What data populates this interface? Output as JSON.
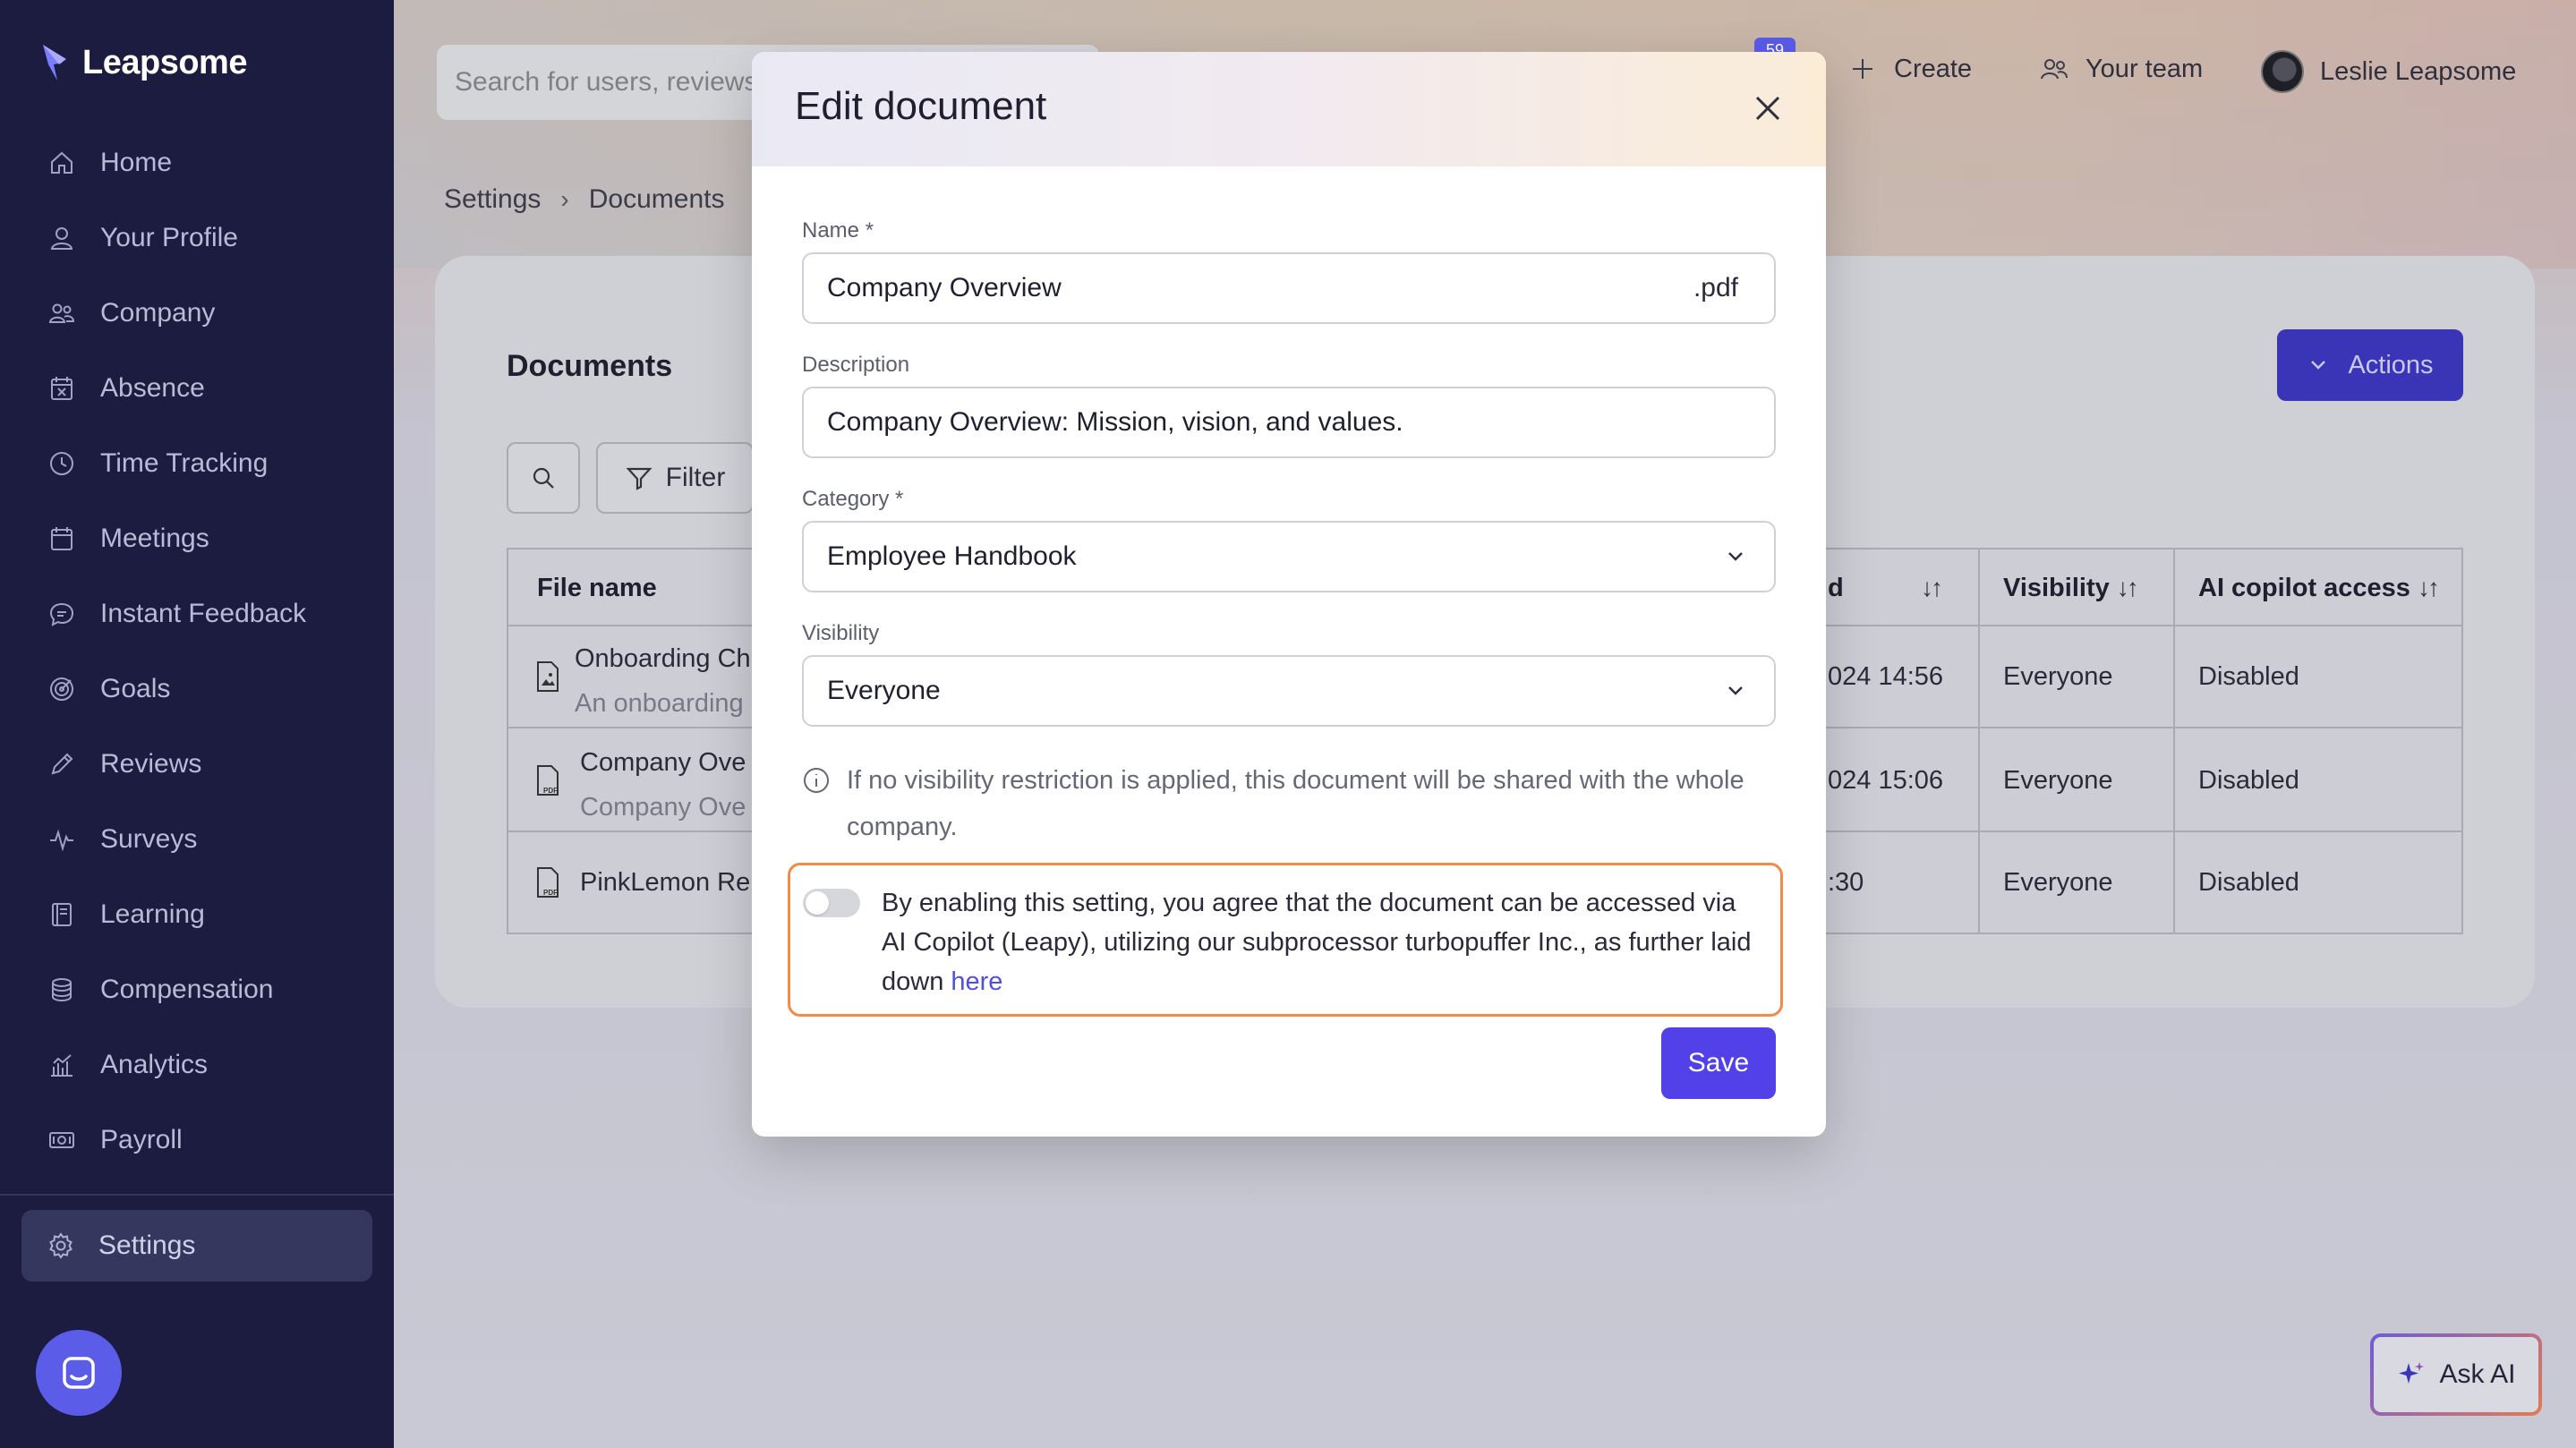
{
  "app": {
    "name": "Leapsome"
  },
  "sidebar": {
    "items": [
      {
        "label": "Home",
        "icon": "home-icon"
      },
      {
        "label": "Your Profile",
        "icon": "user-icon"
      },
      {
        "label": "Company",
        "icon": "people-icon"
      },
      {
        "label": "Absence",
        "icon": "calendar-x-icon"
      },
      {
        "label": "Time Tracking",
        "icon": "clock-icon"
      },
      {
        "label": "Meetings",
        "icon": "calendar-icon"
      },
      {
        "label": "Instant Feedback",
        "icon": "chat-icon"
      },
      {
        "label": "Goals",
        "icon": "target-icon"
      },
      {
        "label": "Reviews",
        "icon": "pencil-icon"
      },
      {
        "label": "Surveys",
        "icon": "pulse-icon"
      },
      {
        "label": "Learning",
        "icon": "book-icon"
      },
      {
        "label": "Compensation",
        "icon": "coins-icon"
      },
      {
        "label": "Analytics",
        "icon": "chart-icon"
      },
      {
        "label": "Payroll",
        "icon": "money-icon"
      }
    ],
    "settings_label": "Settings"
  },
  "topbar": {
    "search_placeholder": "Search for users, reviews",
    "notification_count": "59",
    "create_label": "Create",
    "team_label": "Your team",
    "user_name": "Leslie Leapsome"
  },
  "breadcrumb": {
    "root": "Settings",
    "current": "Documents"
  },
  "documents": {
    "title": "Documents",
    "actions_label": "Actions",
    "filter_label": "Filter",
    "columns": {
      "file_name": "File name",
      "updated": "d",
      "visibility": "Visibility",
      "ai_access": "AI copilot access"
    },
    "rows": [
      {
        "name": "Onboarding Ch",
        "sub": "An onboarding",
        "updated": "024 14:56",
        "visibility": "Everyone",
        "ai_access": "Disabled"
      },
      {
        "name": "Company Ove",
        "sub": "Company Ove",
        "updated": "024 15:06",
        "visibility": "Everyone",
        "ai_access": "Disabled"
      },
      {
        "name": "PinkLemon Re",
        "sub": "",
        "updated": ":30",
        "visibility": "Everyone",
        "ai_access": "Disabled"
      }
    ]
  },
  "ask_ai_label": "Ask AI",
  "modal": {
    "title": "Edit document",
    "name_label": "Name *",
    "name_value": "Company Overview",
    "name_suffix": ".pdf",
    "description_label": "Description",
    "description_value": "Company Overview: Mission, vision, and values.",
    "category_label": "Category *",
    "category_value": "Employee Handbook",
    "visibility_label": "Visibility",
    "visibility_value": "Everyone",
    "info_text": "If no visibility restriction is applied, this document will be shared with the whole company.",
    "consent_text": "By enabling this setting, you agree that the document can be accessed via AI Copilot (Leapy), utilizing our subprocessor turbopuffer Inc., as further laid down",
    "consent_link": "here",
    "consent_enabled": false,
    "save_label": "Save"
  },
  "colors": {
    "sidebar": "#1c1c40",
    "accent": "#5240e8",
    "consent_border": "#f28a4a"
  }
}
